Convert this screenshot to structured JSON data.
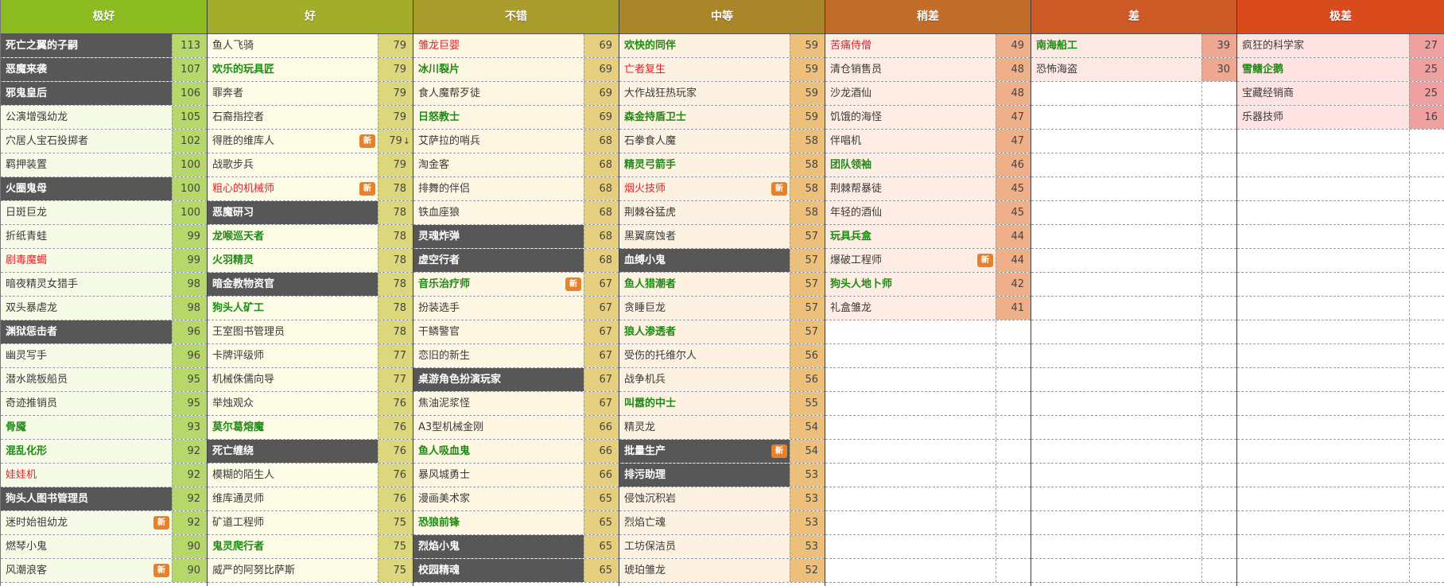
{
  "columns": [
    {
      "title": "极好",
      "header_color": "#8dbc22",
      "cell_bg": "#f6fbe8",
      "score_bg": "#b6d86a",
      "rows": [
        {
          "name": "死亡之翼的子嗣",
          "score": "113",
          "style": "dark"
        },
        {
          "name": "恶魔来袭",
          "score": "107",
          "style": "dark"
        },
        {
          "name": "邪鬼皇后",
          "score": "106",
          "style": "dark"
        },
        {
          "name": "公演增强幼龙",
          "score": "105",
          "style": "normal"
        },
        {
          "name": "穴居人宝石投掷者",
          "score": "102",
          "style": "normal"
        },
        {
          "name": "羁押装置",
          "score": "100",
          "style": "normal"
        },
        {
          "name": "火圈鬼母",
          "score": "100",
          "style": "dark"
        },
        {
          "name": "日斑巨龙",
          "score": "100",
          "style": "normal"
        },
        {
          "name": "折纸青蛙",
          "score": "99",
          "style": "normal"
        },
        {
          "name": "剧毒魔蝎",
          "score": "99",
          "style": "red"
        },
        {
          "name": "暗夜精灵女猎手",
          "score": "98",
          "style": "normal"
        },
        {
          "name": "双头暴虐龙",
          "score": "98",
          "style": "normal"
        },
        {
          "name": "渊狱惩击者",
          "score": "96",
          "style": "dark"
        },
        {
          "name": "幽灵写手",
          "score": "96",
          "style": "normal"
        },
        {
          "name": "潜水跳板船员",
          "score": "95",
          "style": "normal"
        },
        {
          "name": "奇迹推销员",
          "score": "95",
          "style": "normal"
        },
        {
          "name": "骨魇",
          "score": "93",
          "style": "green"
        },
        {
          "name": "混乱化形",
          "score": "92",
          "style": "green"
        },
        {
          "name": "娃娃机",
          "score": "92",
          "style": "red"
        },
        {
          "name": "狗头人图书管理员",
          "score": "92",
          "style": "dark"
        },
        {
          "name": "迷时始祖幼龙",
          "score": "92",
          "style": "normal",
          "badge": "新"
        },
        {
          "name": "燃琴小鬼",
          "score": "90",
          "style": "normal"
        },
        {
          "name": "风潮浪客",
          "score": "90",
          "style": "normal",
          "badge": "新"
        }
      ]
    },
    {
      "title": "好",
      "header_color": "#a2ad2a",
      "cell_bg": "#fcfbe6",
      "score_bg": "#dcd77c",
      "rows": [
        {
          "name": "鱼人飞骑",
          "score": "79",
          "style": "normal"
        },
        {
          "name": "欢乐的玩具匠",
          "score": "79",
          "style": "green"
        },
        {
          "name": "罪奔者",
          "score": "79",
          "style": "normal"
        },
        {
          "name": "石裔指控者",
          "score": "79",
          "style": "normal"
        },
        {
          "name": "得胜的维库人",
          "score": "79",
          "style": "normal",
          "badge": "新",
          "trend": "↓"
        },
        {
          "name": "战歌步兵",
          "score": "79",
          "style": "normal"
        },
        {
          "name": "粗心的机械师",
          "score": "78",
          "style": "red",
          "badge": "新"
        },
        {
          "name": "恶魔研习",
          "score": "78",
          "style": "dark"
        },
        {
          "name": "龙喉巡天者",
          "score": "78",
          "style": "green"
        },
        {
          "name": "火羽精灵",
          "score": "78",
          "style": "green"
        },
        {
          "name": "暗金教物资官",
          "score": "78",
          "style": "dark"
        },
        {
          "name": "狗头人矿工",
          "score": "78",
          "style": "green"
        },
        {
          "name": "王室图书管理员",
          "score": "78",
          "style": "normal"
        },
        {
          "name": "卡牌评级师",
          "score": "77",
          "style": "normal"
        },
        {
          "name": "机械侏儒向导",
          "score": "77",
          "style": "normal"
        },
        {
          "name": "举烛观众",
          "score": "76",
          "style": "normal"
        },
        {
          "name": "莫尔葛熔魔",
          "score": "76",
          "style": "green"
        },
        {
          "name": "死亡缠绕",
          "score": "76",
          "style": "dark"
        },
        {
          "name": "模糊的陌生人",
          "score": "76",
          "style": "normal"
        },
        {
          "name": "维库通灵师",
          "score": "76",
          "style": "normal"
        },
        {
          "name": "矿道工程师",
          "score": "75",
          "style": "normal"
        },
        {
          "name": "鬼灵爬行者",
          "score": "75",
          "style": "green"
        },
        {
          "name": "威严的阿努比萨斯",
          "score": "75",
          "style": "normal"
        }
      ]
    },
    {
      "title": "不错",
      "header_color": "#aa9c2c",
      "cell_bg": "#fcf6e3",
      "score_bg": "#e5cf7e",
      "rows": [
        {
          "name": "雏龙巨婴",
          "score": "69",
          "style": "red"
        },
        {
          "name": "冰川裂片",
          "score": "69",
          "style": "green"
        },
        {
          "name": "食人魔帮歹徒",
          "score": "69",
          "style": "normal"
        },
        {
          "name": "日怒教士",
          "score": "69",
          "style": "green"
        },
        {
          "name": "艾萨拉的哨兵",
          "score": "68",
          "style": "normal"
        },
        {
          "name": "淘金客",
          "score": "68",
          "style": "normal"
        },
        {
          "name": "排舞的伴侣",
          "score": "68",
          "style": "normal"
        },
        {
          "name": "铁血座狼",
          "score": "68",
          "style": "normal"
        },
        {
          "name": "灵魂炸弹",
          "score": "68",
          "style": "dark"
        },
        {
          "name": "虚空行者",
          "score": "68",
          "style": "dark"
        },
        {
          "name": "音乐治疗师",
          "score": "67",
          "style": "green",
          "badge": "新"
        },
        {
          "name": "扮装选手",
          "score": "67",
          "style": "normal"
        },
        {
          "name": "干鳞警官",
          "score": "67",
          "style": "normal"
        },
        {
          "name": "恋旧的新生",
          "score": "67",
          "style": "normal"
        },
        {
          "name": "桌游角色扮演玩家",
          "score": "67",
          "style": "dark"
        },
        {
          "name": "焦油泥浆怪",
          "score": "67",
          "style": "normal"
        },
        {
          "name": "A3型机械金刚",
          "score": "66",
          "style": "normal"
        },
        {
          "name": "鱼人吸血鬼",
          "score": "66",
          "style": "green"
        },
        {
          "name": "暴风城勇士",
          "score": "66",
          "style": "normal"
        },
        {
          "name": "漫画美术家",
          "score": "65",
          "style": "normal"
        },
        {
          "name": "恐狼前锋",
          "score": "65",
          "style": "green"
        },
        {
          "name": "烈焰小鬼",
          "score": "65",
          "style": "dark"
        },
        {
          "name": "校园精魂",
          "score": "65",
          "style": "dark"
        }
      ]
    },
    {
      "title": "中等",
      "header_color": "#ab8529",
      "cell_bg": "#fdf1e1",
      "score_bg": "#ecc07b",
      "rows": [
        {
          "name": "欢快的同伴",
          "score": "59",
          "style": "green"
        },
        {
          "name": "亡者复生",
          "score": "59",
          "style": "red"
        },
        {
          "name": "大作战狂热玩家",
          "score": "59",
          "style": "normal"
        },
        {
          "name": "森金持盾卫士",
          "score": "59",
          "style": "green"
        },
        {
          "name": "石拳食人魔",
          "score": "58",
          "style": "normal"
        },
        {
          "name": "精灵弓箭手",
          "score": "58",
          "style": "green"
        },
        {
          "name": "烟火技师",
          "score": "58",
          "style": "red",
          "badge": "新"
        },
        {
          "name": "荆棘谷猛虎",
          "score": "58",
          "style": "normal"
        },
        {
          "name": "黑翼腐蚀者",
          "score": "57",
          "style": "normal"
        },
        {
          "name": "血缚小鬼",
          "score": "57",
          "style": "dark"
        },
        {
          "name": "鱼人猎潮者",
          "score": "57",
          "style": "green"
        },
        {
          "name": "贪睡巨龙",
          "score": "57",
          "style": "normal"
        },
        {
          "name": "狼人渗透者",
          "score": "57",
          "style": "green"
        },
        {
          "name": "受伤的托维尔人",
          "score": "56",
          "style": "normal"
        },
        {
          "name": "战争机兵",
          "score": "56",
          "style": "normal"
        },
        {
          "name": "叫嚣的中士",
          "score": "55",
          "style": "green"
        },
        {
          "name": "精灵龙",
          "score": "54",
          "style": "normal"
        },
        {
          "name": "批量生产",
          "score": "54",
          "style": "dark",
          "badge": "新"
        },
        {
          "name": "排污助理",
          "score": "53",
          "style": "dark"
        },
        {
          "name": "侵蚀沉积岩",
          "score": "53",
          "style": "normal"
        },
        {
          "name": "烈焰亡魂",
          "score": "53",
          "style": "normal"
        },
        {
          "name": "工坊保洁员",
          "score": "53",
          "style": "normal"
        },
        {
          "name": "琥珀雏龙",
          "score": "52",
          "style": "normal"
        }
      ]
    },
    {
      "title": "稍差",
      "header_color": "#c26d2a",
      "cell_bg": "#fdede4",
      "score_bg": "#efb089",
      "rows": [
        {
          "name": "苦痛侍僧",
          "score": "49",
          "style": "red"
        },
        {
          "name": "清仓销售员",
          "score": "48",
          "style": "normal"
        },
        {
          "name": "沙龙酒仙",
          "score": "48",
          "style": "normal"
        },
        {
          "name": "饥饿的海怪",
          "score": "47",
          "style": "normal"
        },
        {
          "name": "伴唱机",
          "score": "47",
          "style": "normal"
        },
        {
          "name": "团队领袖",
          "score": "46",
          "style": "green"
        },
        {
          "name": "荆棘帮暴徒",
          "score": "45",
          "style": "normal"
        },
        {
          "name": "年轻的酒仙",
          "score": "45",
          "style": "normal"
        },
        {
          "name": "玩具兵盒",
          "score": "44",
          "style": "green"
        },
        {
          "name": "爆破工程师",
          "score": "44",
          "style": "normal",
          "badge": "新"
        },
        {
          "name": "狗头人地卜师",
          "score": "42",
          "style": "green"
        },
        {
          "name": "礼盒雏龙",
          "score": "41",
          "style": "normal"
        }
      ]
    },
    {
      "title": "差",
      "header_color": "#cc5a27",
      "cell_bg": "#fde9e3",
      "score_bg": "#eea790",
      "rows": [
        {
          "name": "南海船工",
          "score": "39",
          "style": "green"
        },
        {
          "name": "恐怖海盗",
          "score": "30",
          "style": "normal"
        }
      ]
    },
    {
      "title": "极差",
      "header_color": "#d94a1d",
      "cell_bg": "#fde4e2",
      "score_bg": "#eea1a0",
      "rows": [
        {
          "name": "疯狂的科学家",
          "score": "27",
          "style": "normal"
        },
        {
          "name": "雪鳍企鹅",
          "score": "25",
          "style": "green"
        },
        {
          "name": "宝藏经销商",
          "score": "25",
          "style": "normal"
        },
        {
          "name": "乐器技师",
          "score": "16",
          "style": "normal"
        }
      ]
    }
  ]
}
